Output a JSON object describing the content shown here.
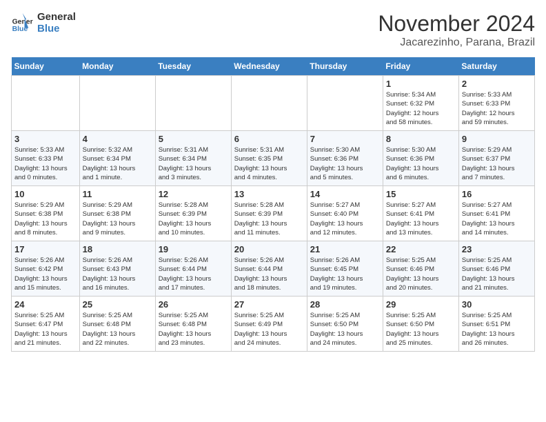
{
  "header": {
    "logo_line1": "General",
    "logo_line2": "Blue",
    "month": "November 2024",
    "location": "Jacarezinho, Parana, Brazil"
  },
  "weekdays": [
    "Sunday",
    "Monday",
    "Tuesday",
    "Wednesday",
    "Thursday",
    "Friday",
    "Saturday"
  ],
  "weeks": [
    [
      {
        "day": "",
        "info": ""
      },
      {
        "day": "",
        "info": ""
      },
      {
        "day": "",
        "info": ""
      },
      {
        "day": "",
        "info": ""
      },
      {
        "day": "",
        "info": ""
      },
      {
        "day": "1",
        "info": "Sunrise: 5:34 AM\nSunset: 6:32 PM\nDaylight: 12 hours\nand 58 minutes."
      },
      {
        "day": "2",
        "info": "Sunrise: 5:33 AM\nSunset: 6:33 PM\nDaylight: 12 hours\nand 59 minutes."
      }
    ],
    [
      {
        "day": "3",
        "info": "Sunrise: 5:33 AM\nSunset: 6:33 PM\nDaylight: 13 hours\nand 0 minutes."
      },
      {
        "day": "4",
        "info": "Sunrise: 5:32 AM\nSunset: 6:34 PM\nDaylight: 13 hours\nand 1 minute."
      },
      {
        "day": "5",
        "info": "Sunrise: 5:31 AM\nSunset: 6:34 PM\nDaylight: 13 hours\nand 3 minutes."
      },
      {
        "day": "6",
        "info": "Sunrise: 5:31 AM\nSunset: 6:35 PM\nDaylight: 13 hours\nand 4 minutes."
      },
      {
        "day": "7",
        "info": "Sunrise: 5:30 AM\nSunset: 6:36 PM\nDaylight: 13 hours\nand 5 minutes."
      },
      {
        "day": "8",
        "info": "Sunrise: 5:30 AM\nSunset: 6:36 PM\nDaylight: 13 hours\nand 6 minutes."
      },
      {
        "day": "9",
        "info": "Sunrise: 5:29 AM\nSunset: 6:37 PM\nDaylight: 13 hours\nand 7 minutes."
      }
    ],
    [
      {
        "day": "10",
        "info": "Sunrise: 5:29 AM\nSunset: 6:38 PM\nDaylight: 13 hours\nand 8 minutes."
      },
      {
        "day": "11",
        "info": "Sunrise: 5:29 AM\nSunset: 6:38 PM\nDaylight: 13 hours\nand 9 minutes."
      },
      {
        "day": "12",
        "info": "Sunrise: 5:28 AM\nSunset: 6:39 PM\nDaylight: 13 hours\nand 10 minutes."
      },
      {
        "day": "13",
        "info": "Sunrise: 5:28 AM\nSunset: 6:39 PM\nDaylight: 13 hours\nand 11 minutes."
      },
      {
        "day": "14",
        "info": "Sunrise: 5:27 AM\nSunset: 6:40 PM\nDaylight: 13 hours\nand 12 minutes."
      },
      {
        "day": "15",
        "info": "Sunrise: 5:27 AM\nSunset: 6:41 PM\nDaylight: 13 hours\nand 13 minutes."
      },
      {
        "day": "16",
        "info": "Sunrise: 5:27 AM\nSunset: 6:41 PM\nDaylight: 13 hours\nand 14 minutes."
      }
    ],
    [
      {
        "day": "17",
        "info": "Sunrise: 5:26 AM\nSunset: 6:42 PM\nDaylight: 13 hours\nand 15 minutes."
      },
      {
        "day": "18",
        "info": "Sunrise: 5:26 AM\nSunset: 6:43 PM\nDaylight: 13 hours\nand 16 minutes."
      },
      {
        "day": "19",
        "info": "Sunrise: 5:26 AM\nSunset: 6:44 PM\nDaylight: 13 hours\nand 17 minutes."
      },
      {
        "day": "20",
        "info": "Sunrise: 5:26 AM\nSunset: 6:44 PM\nDaylight: 13 hours\nand 18 minutes."
      },
      {
        "day": "21",
        "info": "Sunrise: 5:26 AM\nSunset: 6:45 PM\nDaylight: 13 hours\nand 19 minutes."
      },
      {
        "day": "22",
        "info": "Sunrise: 5:25 AM\nSunset: 6:46 PM\nDaylight: 13 hours\nand 20 minutes."
      },
      {
        "day": "23",
        "info": "Sunrise: 5:25 AM\nSunset: 6:46 PM\nDaylight: 13 hours\nand 21 minutes."
      }
    ],
    [
      {
        "day": "24",
        "info": "Sunrise: 5:25 AM\nSunset: 6:47 PM\nDaylight: 13 hours\nand 21 minutes."
      },
      {
        "day": "25",
        "info": "Sunrise: 5:25 AM\nSunset: 6:48 PM\nDaylight: 13 hours\nand 22 minutes."
      },
      {
        "day": "26",
        "info": "Sunrise: 5:25 AM\nSunset: 6:48 PM\nDaylight: 13 hours\nand 23 minutes."
      },
      {
        "day": "27",
        "info": "Sunrise: 5:25 AM\nSunset: 6:49 PM\nDaylight: 13 hours\nand 24 minutes."
      },
      {
        "day": "28",
        "info": "Sunrise: 5:25 AM\nSunset: 6:50 PM\nDaylight: 13 hours\nand 24 minutes."
      },
      {
        "day": "29",
        "info": "Sunrise: 5:25 AM\nSunset: 6:50 PM\nDaylight: 13 hours\nand 25 minutes."
      },
      {
        "day": "30",
        "info": "Sunrise: 5:25 AM\nSunset: 6:51 PM\nDaylight: 13 hours\nand 26 minutes."
      }
    ]
  ]
}
